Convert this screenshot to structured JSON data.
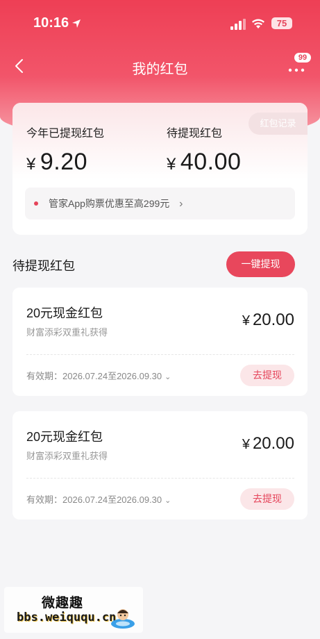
{
  "status_bar": {
    "time": "10:16",
    "battery": "75",
    "icons": [
      "location-arrow-icon",
      "signal-icon",
      "wifi-icon",
      "battery-icon"
    ]
  },
  "nav": {
    "title": "我的红包",
    "back_icon": "chevron-left-icon",
    "more_icon": "more-dots-icon",
    "message_badge": "99"
  },
  "summary": {
    "record_label": "红包记录",
    "withdrawn_label": "今年已提现红包",
    "withdrawn_currency": "¥",
    "withdrawn_amount": "9.20",
    "pending_label": "待提现红包",
    "pending_currency": "¥",
    "pending_amount": "40.00",
    "promo_text": "管家App购票优惠至高299元",
    "promo_chevron": "›"
  },
  "section": {
    "title": "待提现红包",
    "withdraw_all_label": "一键提现"
  },
  "cards": [
    {
      "title": "20元现金红包",
      "subtitle": "财富添彩双重礼获得",
      "currency": "¥",
      "amount": "20.00",
      "validity": "有效期：2026.07.24至2026.09.30",
      "action_label": "去提现"
    },
    {
      "title": "20元现金红包",
      "subtitle": "财富添彩双重礼获得",
      "currency": "¥",
      "amount": "20.00",
      "validity": "有效期：2026.07.24至2026.09.30",
      "action_label": "去提现"
    }
  ],
  "watermark": {
    "cn": "微趣趣",
    "en": "bbs.weiququ.cn"
  },
  "colors": {
    "brand_red": "#e8475c",
    "light_pink": "#fbe6e8",
    "page_bg": "#f5f5f7"
  }
}
